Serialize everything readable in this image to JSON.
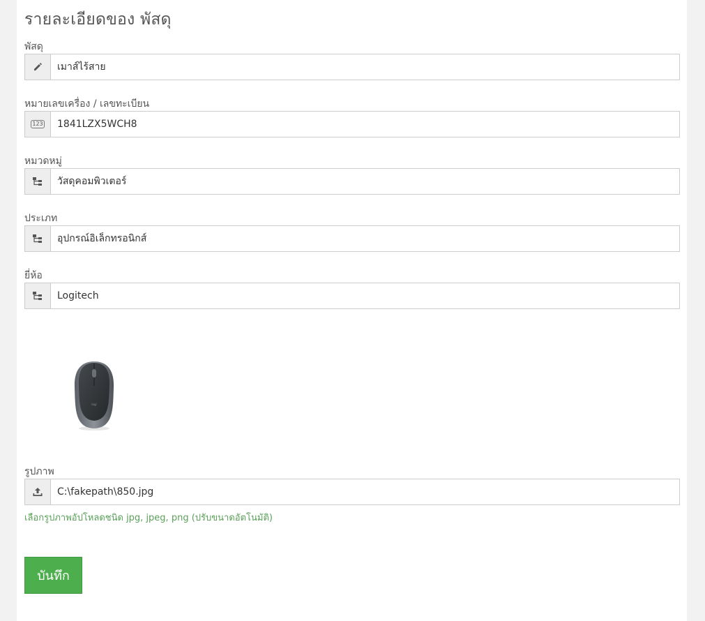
{
  "page": {
    "title": "รายละเอียดของ พัสดุ"
  },
  "fields": {
    "item": {
      "label": "พัสดุ",
      "value": "เมาส์ไร้สาย",
      "icon": "pencil-icon"
    },
    "serial": {
      "label": "หมายเลขเครื่อง / เลขทะเบียน",
      "value": "1841LZX5WCH8",
      "icon": "numbers-icon",
      "icon_text": "123"
    },
    "category": {
      "label": "หมวดหมู่",
      "value": "วัสดุคอมพิวเตอร์",
      "icon": "tree-icon"
    },
    "type": {
      "label": "ประเภท",
      "value": "อุปกรณ์อิเล็กทรอนิกส์",
      "icon": "tree-icon"
    },
    "brand": {
      "label": "ยี่ห้อ",
      "value": "Logitech",
      "icon": "tree-icon"
    }
  },
  "image": {
    "preview": "mouse-image",
    "label": "รูปภาพ",
    "value": "C:\\fakepath\\850.jpg",
    "icon": "upload-icon",
    "help": "เลือกรูปภาพอัปโหลดชนิด jpg, jpeg, png (ปรับขนาดอัตโนมัติ)"
  },
  "actions": {
    "save_label": "บันทึก"
  },
  "colors": {
    "save_button": "#4cae4c",
    "help_text": "#5aa05a",
    "background": "#f2f2f2"
  }
}
